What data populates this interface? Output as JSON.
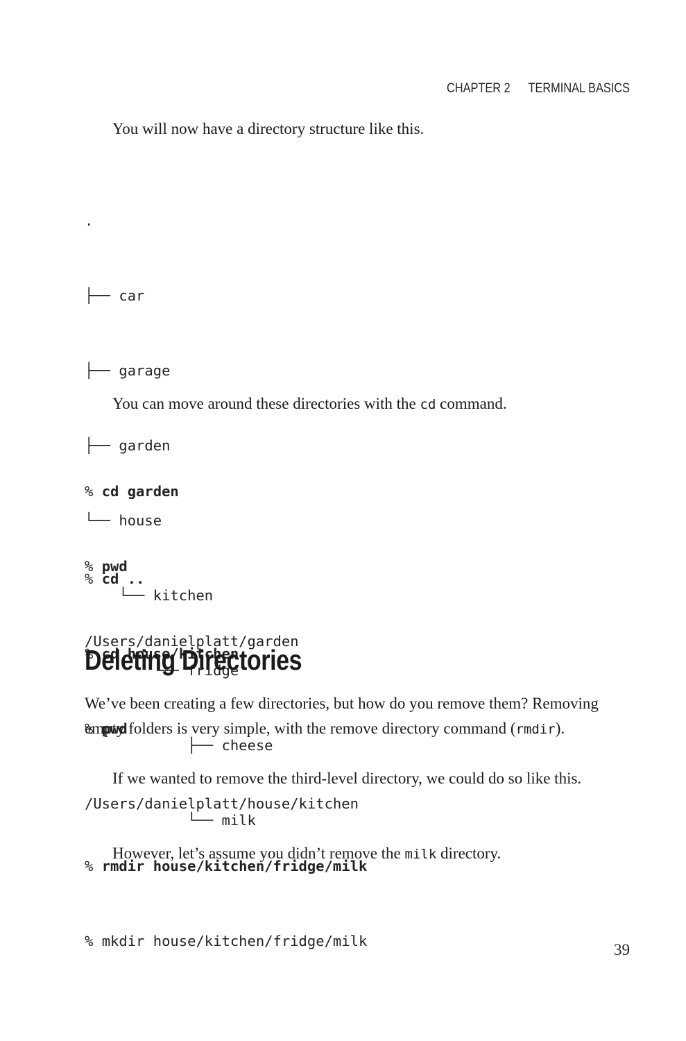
{
  "running_head": {
    "chapter": "CHAPTER 2",
    "title": "TERMINAL BASICS"
  },
  "intro_paragraph": "You will now have a directory structure like this.",
  "directory_tree": [
    ".",
    "├── car",
    "├── garage",
    "├── garden",
    "└── house",
    "    └── kitchen",
    "        └── fridge",
    "            ├── cheese",
    "            └── milk"
  ],
  "move_paragraph": {
    "before": "You can move around these directories with the ",
    "code": "cd",
    "after": " command."
  },
  "code_block_1": [
    {
      "prompt": "% ",
      "command": "cd garden",
      "bold": true
    },
    {
      "prompt": "% ",
      "command": "pwd",
      "bold": true
    },
    {
      "prompt": "",
      "command": "/Users/danielplatt/garden",
      "bold": false
    }
  ],
  "code_block_2": [
    {
      "prompt": "% ",
      "command": "cd ..",
      "bold": true
    },
    {
      "prompt": "% ",
      "command": "cd house/kitchen",
      "bold": true
    },
    {
      "prompt": "% ",
      "command": "pwd",
      "bold": true
    },
    {
      "prompt": "",
      "command": "/Users/danielplatt/house/kitchen",
      "bold": false
    }
  ],
  "section_heading": "Deleting Directories",
  "deleting_paragraph": {
    "text": "We’ve been creating a few directories, but how do you remove them? Removing empty folders is very simple, with the remove directory command (",
    "code": "rmdir",
    "after": ")."
  },
  "third_level_paragraph": "If we wanted to remove the third-level directory, we could do so like this.",
  "code_block_3": [
    {
      "prompt": "% ",
      "command": "rmdir house/kitchen/fridge/milk",
      "bold": true
    }
  ],
  "however_paragraph": {
    "before": "However, let’s assume you didn’t remove the ",
    "code": "milk",
    "after": " directory."
  },
  "code_block_4": [
    {
      "prompt": "% ",
      "command": "mkdir house/kitchen/fridge/milk",
      "bold": false
    }
  ],
  "page_number": "39"
}
